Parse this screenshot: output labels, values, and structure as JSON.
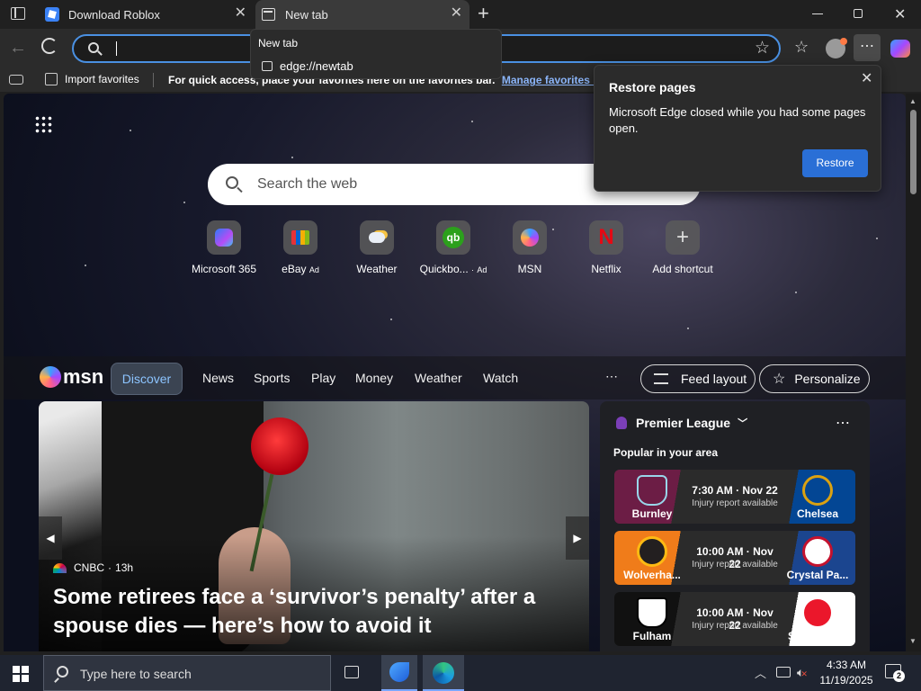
{
  "browser": {
    "tabs": [
      {
        "title": "Download Roblox",
        "active": false
      },
      {
        "title": "New tab",
        "active": true
      }
    ],
    "tab_tooltip": {
      "title": "New tab",
      "url": "edge://newtab"
    },
    "address_bar": {
      "value": ""
    },
    "favorites_bar": {
      "import_label": "Import favorites",
      "quick_access_text": "For quick access, place your favorites here on the favorites bar.",
      "manage_link": "Manage favorites now"
    }
  },
  "restore_popup": {
    "title": "Restore pages",
    "message": "Microsoft Edge closed while you had some pages open.",
    "button": "Restore"
  },
  "newtab": {
    "search_placeholder": "Search the web",
    "shortcuts": [
      {
        "name": "Microsoft 365",
        "ad": ""
      },
      {
        "name": "eBay",
        "ad": "Ad"
      },
      {
        "name": "Weather",
        "ad": ""
      },
      {
        "name": "Quickbo...",
        "ad": "Ad"
      },
      {
        "name": "MSN",
        "ad": ""
      },
      {
        "name": "Netflix",
        "ad": ""
      },
      {
        "name": "Add shortcut",
        "ad": ""
      }
    ]
  },
  "msn": {
    "logo_text": "msn",
    "nav": [
      "Discover",
      "News",
      "Sports",
      "Play",
      "Money",
      "Weather",
      "Watch"
    ],
    "more": "⋯",
    "feed_layout": "Feed layout",
    "personalize": "Personalize",
    "article": {
      "source": "CNBC",
      "age": "13h",
      "headline": "Some retirees face a ‘survivor’s penalty’ after a spouse dies — here’s how to avoid it"
    },
    "sports": {
      "league": "Premier League",
      "subtitle": "Popular in your area",
      "matches": [
        {
          "home": "Burnley",
          "away": "Chelsea",
          "time": "7:30 AM · Nov 22",
          "note": "Injury report available",
          "home_color": "#6c1d45",
          "away_color": "#034694"
        },
        {
          "home": "Wolverha...",
          "away": "Crystal Pa...",
          "time": "10:00 AM · Nov 22",
          "note": "Injury report available",
          "home_color": "#fdb913",
          "away_color": "#1b458f"
        },
        {
          "home": "Fulham",
          "away": "Sunderland",
          "time": "10:00 AM · Nov 22",
          "note": "Injury report available",
          "home_color": "#000000",
          "away_color": "#eb172b"
        }
      ]
    }
  },
  "taskbar": {
    "search_placeholder": "Type here to search",
    "time": "4:33 AM",
    "date": "11/19/2025",
    "notification_count": "2"
  }
}
